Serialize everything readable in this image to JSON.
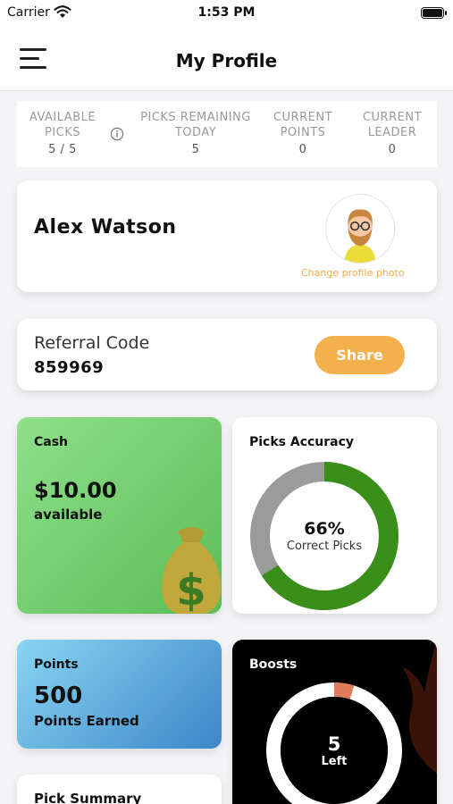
{
  "status_bar": {
    "carrier": "Carrier",
    "time": "1:53 PM"
  },
  "nav": {
    "title": "My Profile"
  },
  "stats": {
    "available_picks": {
      "label1": "AVAILABLE",
      "label2": "PICKS",
      "value": "5 / 5"
    },
    "picks_remaining": {
      "label1": "PICKS REMAINING",
      "label2": "TODAY",
      "value": "5"
    },
    "current_points": {
      "label1": "CURRENT",
      "label2": "POINTS",
      "value": "0"
    },
    "current_leader": {
      "label1": "CURRENT",
      "label2": "LEADER",
      "value": "0"
    }
  },
  "profile": {
    "name": "Alex Watson",
    "change_photo": "Change profile photo"
  },
  "referral": {
    "label": "Referral Code",
    "code": "859969",
    "share_label": "Share"
  },
  "cash": {
    "title": "Cash",
    "amount": "$10.00",
    "caption": "available"
  },
  "accuracy": {
    "title": "Picks Accuracy",
    "percent_text": "66%",
    "caption": "Correct Picks",
    "fraction": 0.66,
    "color_correct": "#3a8e1a",
    "color_rest": "#9b9b9b"
  },
  "points": {
    "title": "Points",
    "amount": "500",
    "caption": "Points Earned"
  },
  "boosts": {
    "title": "Boosts",
    "count": "5",
    "caption": "Left"
  },
  "pick_summary": {
    "title": "Pick Summary"
  },
  "colors": {
    "accent": "#f5b04e",
    "cash_gradient_start": "#8fe08a",
    "cash_gradient_end": "#5bbd56",
    "points_gradient_start": "#89d5f2",
    "points_gradient_end": "#3d86c8",
    "boosts_bg": "#000000"
  }
}
